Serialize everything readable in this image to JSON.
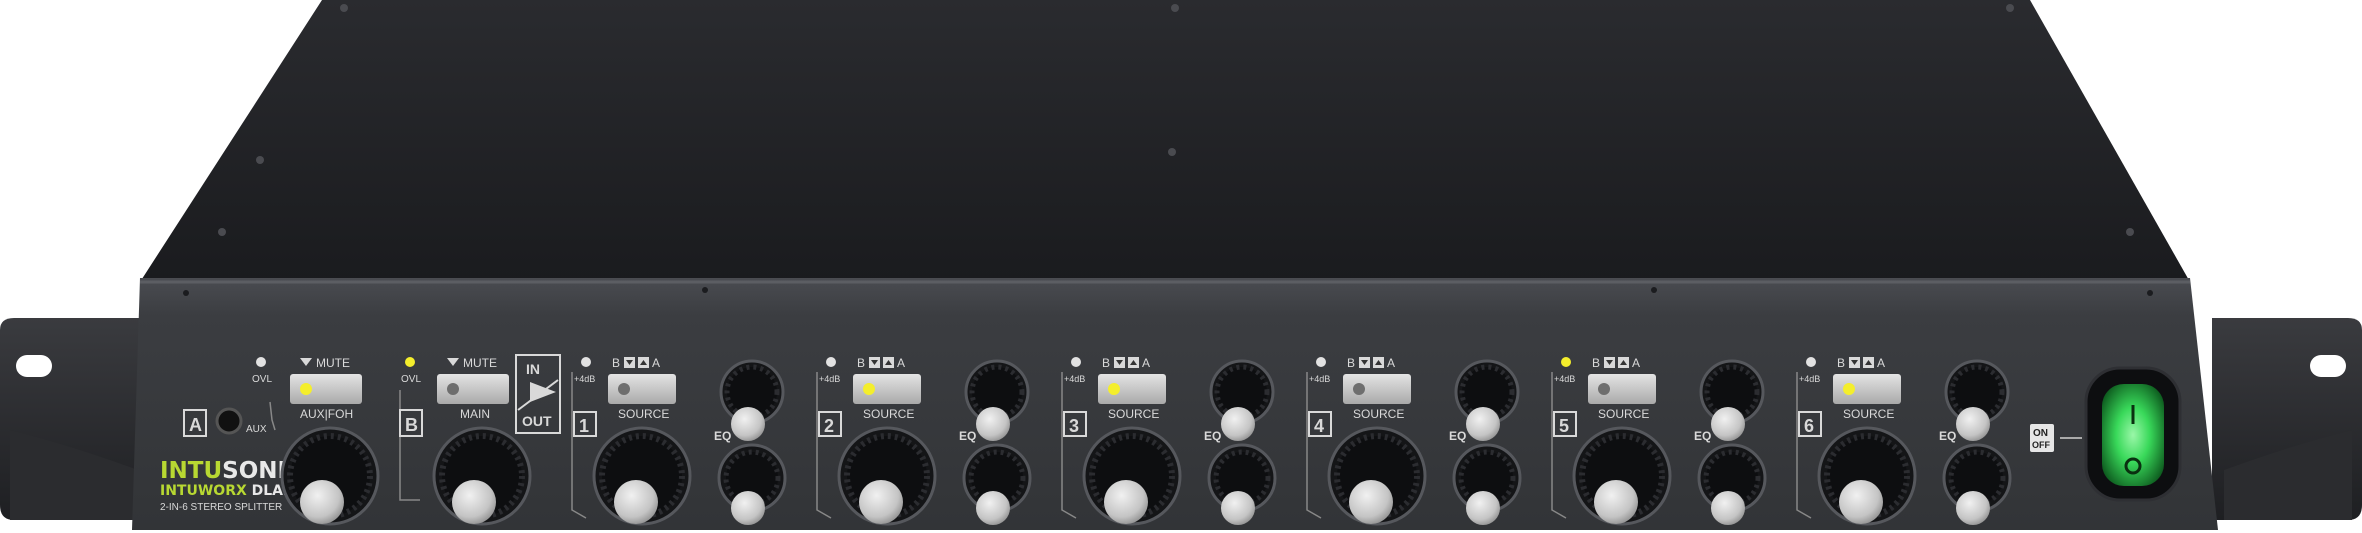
{
  "brand": {
    "logo_a": "INTU",
    "logo_b": "SONIC",
    "line_a": "INTU",
    "line_b": "WORX",
    "model": "DLA26",
    "tagline": "2-IN-6 STEREO SPLITTER"
  },
  "input_a": {
    "letter": "A",
    "ovl": "OVL",
    "mute": "MUTE",
    "name": "AUX|FOH",
    "aux": "AUX",
    "led_on": true
  },
  "input_b": {
    "letter": "B",
    "ovl": "OVL",
    "mute": "MUTE",
    "name": "MAIN",
    "led_on": false
  },
  "inout": {
    "in": "IN",
    "out": "OUT"
  },
  "channels": [
    {
      "num": "1",
      "gain": "+4dB",
      "b": "B",
      "a": "A",
      "source": "SOURCE",
      "eq": "EQ",
      "led_on": false,
      "ovl_on": false
    },
    {
      "num": "2",
      "gain": "+4dB",
      "b": "B",
      "a": "A",
      "source": "SOURCE",
      "eq": "EQ",
      "led_on": true,
      "ovl_on": false
    },
    {
      "num": "3",
      "gain": "+4dB",
      "b": "B",
      "a": "A",
      "source": "SOURCE",
      "eq": "EQ",
      "led_on": true,
      "ovl_on": false
    },
    {
      "num": "4",
      "gain": "+4dB",
      "b": "B",
      "a": "A",
      "source": "SOURCE",
      "eq": "EQ",
      "led_on": false,
      "ovl_on": false
    },
    {
      "num": "5",
      "gain": "+4dB",
      "b": "B",
      "a": "A",
      "source": "SOURCE",
      "eq": "EQ",
      "led_on": false,
      "ovl_on": true
    },
    {
      "num": "6",
      "gain": "+4dB",
      "b": "B",
      "a": "A",
      "source": "SOURCE",
      "eq": "EQ",
      "led_on": true,
      "ovl_on": false
    }
  ],
  "power": {
    "on": "ON",
    "off": "OFF"
  },
  "colors": {
    "led_yellow": "#f4ee2c",
    "power_green": "#39d95a",
    "brand_green": "#b8d832"
  }
}
